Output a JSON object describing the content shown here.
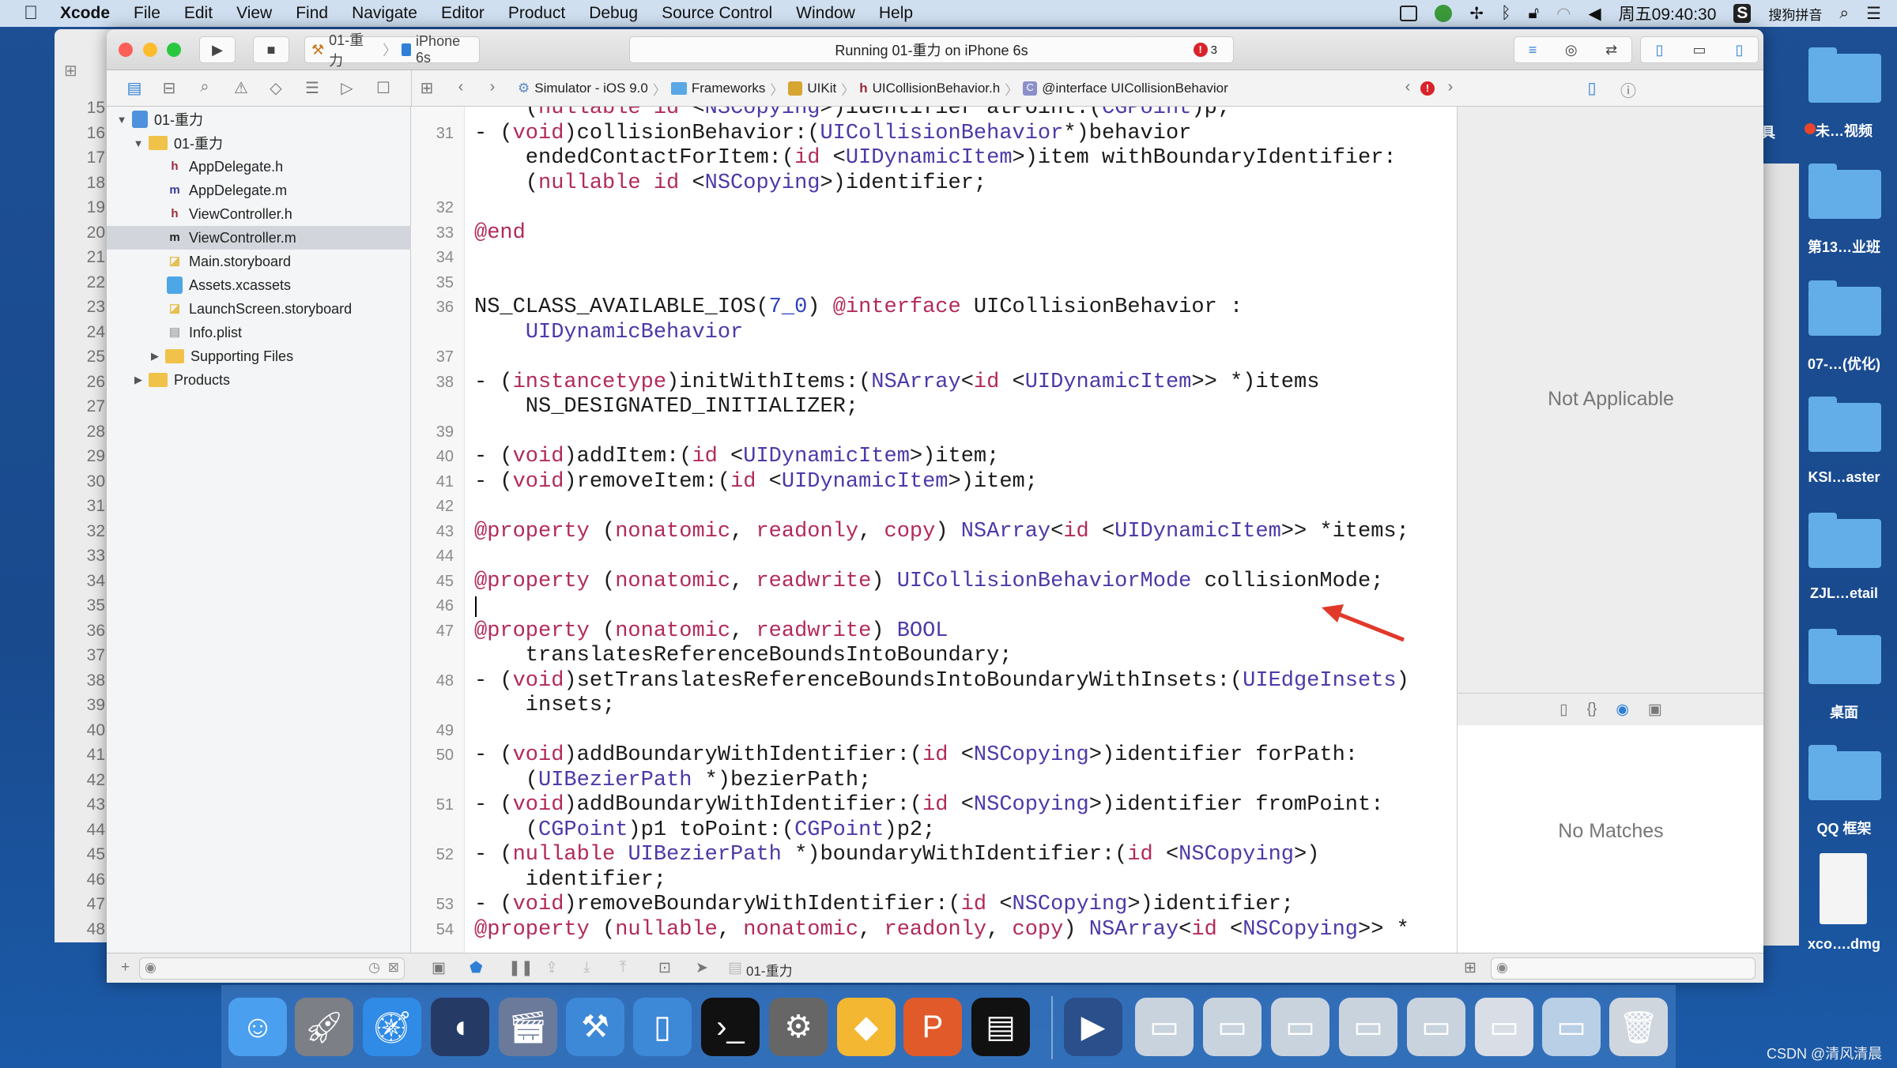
{
  "menubar": {
    "app": "Xcode",
    "items": [
      "File",
      "Edit",
      "View",
      "Find",
      "Navigate",
      "Editor",
      "Product",
      "Debug",
      "Source Control",
      "Window",
      "Help"
    ],
    "clock": "周五09:40:30",
    "ime": "搜狗拼音"
  },
  "toolbar": {
    "scheme": "01-重力",
    "device": "iPhone 6s",
    "status": "Running 01-重力 on iPhone 6s",
    "error_count": "3"
  },
  "jumpbar": {
    "crumbs": [
      "Simulator - iOS 9.0",
      "Frameworks",
      "UIKit",
      "UICollisionBehavior.h",
      "@interface UICollisionBehavior"
    ]
  },
  "navigator": {
    "items": [
      {
        "label": "01-重力",
        "kind": "project",
        "level": 0,
        "expanded": true
      },
      {
        "label": "01-重力",
        "kind": "folder",
        "level": 1,
        "expanded": true
      },
      {
        "label": "AppDelegate.h",
        "kind": "h",
        "level": 2
      },
      {
        "label": "AppDelegate.m",
        "kind": "m",
        "level": 2
      },
      {
        "label": "ViewController.h",
        "kind": "h",
        "level": 2
      },
      {
        "label": "ViewController.m",
        "kind": "m",
        "level": 2,
        "selected": true
      },
      {
        "label": "Main.storyboard",
        "kind": "storyboard",
        "level": 2
      },
      {
        "label": "Assets.xcassets",
        "kind": "assets",
        "level": 2
      },
      {
        "label": "LaunchScreen.storyboard",
        "kind": "storyboard",
        "level": 2
      },
      {
        "label": "Info.plist",
        "kind": "plist",
        "level": 2
      },
      {
        "label": "Supporting Files",
        "kind": "folder",
        "level": 2,
        "expanded": false
      },
      {
        "label": "Products",
        "kind": "folder",
        "level": 1,
        "expanded": false
      }
    ]
  },
  "behind_gutter": [
    "15",
    "16",
    "17",
    "18",
    "19",
    "20",
    "21",
    "22",
    "23",
    "24",
    "25",
    "26",
    "27",
    "28",
    "29",
    "30",
    "31",
    "32",
    "33",
    "34",
    "35",
    "36",
    "37",
    "38",
    "39",
    "40",
    "41",
    "42",
    "43",
    "44",
    "45",
    "46",
    "47",
    "48"
  ],
  "editor": {
    "cursor_line": "46",
    "rows": [
      {
        "n": "",
        "tk": [
          [
            "p",
            "    ("
          ],
          [
            "k",
            "nullable"
          ],
          [
            "p",
            " "
          ],
          [
            "k",
            "id"
          ],
          [
            "p",
            " <"
          ],
          [
            "t",
            "NSCopying"
          ],
          [
            "p",
            ">)identifier atPoint:("
          ],
          [
            "t",
            "CGPoint"
          ],
          [
            "p",
            ")p;"
          ]
        ]
      },
      {
        "n": "31",
        "tk": [
          [
            "p",
            "- ("
          ],
          [
            "k",
            "void"
          ],
          [
            "p",
            ")collisionBehavior:("
          ],
          [
            "t",
            "UICollisionBehavior"
          ],
          [
            "p",
            "*)behavior"
          ]
        ]
      },
      {
        "n": "",
        "tk": [
          [
            "p",
            "    endedContactForItem:("
          ],
          [
            "k",
            "id"
          ],
          [
            "p",
            " <"
          ],
          [
            "t",
            "UIDynamicItem"
          ],
          [
            "p",
            ">)item withBoundaryIdentifier:"
          ]
        ]
      },
      {
        "n": "",
        "tk": [
          [
            "p",
            "    ("
          ],
          [
            "k",
            "nullable"
          ],
          [
            "p",
            " "
          ],
          [
            "k",
            "id"
          ],
          [
            "p",
            " <"
          ],
          [
            "t",
            "NSCopying"
          ],
          [
            "p",
            ">)identifier;"
          ]
        ]
      },
      {
        "n": "32",
        "tk": []
      },
      {
        "n": "33",
        "tk": [
          [
            "k",
            "@end"
          ]
        ]
      },
      {
        "n": "34",
        "tk": []
      },
      {
        "n": "35",
        "tk": []
      },
      {
        "n": "36",
        "tk": [
          [
            "p",
            "NS_CLASS_AVAILABLE_IOS("
          ],
          [
            "n",
            "7_0"
          ],
          [
            "p",
            ") "
          ],
          [
            "k",
            "@interface"
          ],
          [
            "p",
            " UICollisionBehavior :"
          ]
        ]
      },
      {
        "n": "",
        "tk": [
          [
            "p",
            "    "
          ],
          [
            "t",
            "UIDynamicBehavior"
          ]
        ]
      },
      {
        "n": "37",
        "tk": []
      },
      {
        "n": "38",
        "tk": [
          [
            "p",
            "- ("
          ],
          [
            "k",
            "instancetype"
          ],
          [
            "p",
            ")initWithItems:("
          ],
          [
            "t",
            "NSArray"
          ],
          [
            "p",
            "<"
          ],
          [
            "k",
            "id"
          ],
          [
            "p",
            " <"
          ],
          [
            "t",
            "UIDynamicItem"
          ],
          [
            "p",
            ">> *)items"
          ]
        ]
      },
      {
        "n": "",
        "tk": [
          [
            "p",
            "    NS_DESIGNATED_INITIALIZER;"
          ]
        ]
      },
      {
        "n": "39",
        "tk": []
      },
      {
        "n": "40",
        "tk": [
          [
            "p",
            "- ("
          ],
          [
            "k",
            "void"
          ],
          [
            "p",
            ")addItem:("
          ],
          [
            "k",
            "id"
          ],
          [
            "p",
            " <"
          ],
          [
            "t",
            "UIDynamicItem"
          ],
          [
            "p",
            ">)item;"
          ]
        ]
      },
      {
        "n": "41",
        "tk": [
          [
            "p",
            "- ("
          ],
          [
            "k",
            "void"
          ],
          [
            "p",
            ")removeItem:("
          ],
          [
            "k",
            "id"
          ],
          [
            "p",
            " <"
          ],
          [
            "t",
            "UIDynamicItem"
          ],
          [
            "p",
            ">)item;"
          ]
        ]
      },
      {
        "n": "42",
        "tk": []
      },
      {
        "n": "43",
        "tk": [
          [
            "k",
            "@property"
          ],
          [
            "p",
            " ("
          ],
          [
            "k",
            "nonatomic"
          ],
          [
            "p",
            ", "
          ],
          [
            "k",
            "readonly"
          ],
          [
            "p",
            ", "
          ],
          [
            "k",
            "copy"
          ],
          [
            "p",
            ") "
          ],
          [
            "t",
            "NSArray"
          ],
          [
            "p",
            "<"
          ],
          [
            "k",
            "id"
          ],
          [
            "p",
            " <"
          ],
          [
            "t",
            "UIDynamicItem"
          ],
          [
            "p",
            ">> *items;"
          ]
        ]
      },
      {
        "n": "44",
        "tk": []
      },
      {
        "n": "45",
        "tk": [
          [
            "k",
            "@property"
          ],
          [
            "p",
            " ("
          ],
          [
            "k",
            "nonatomic"
          ],
          [
            "p",
            ", "
          ],
          [
            "k",
            "readwrite"
          ],
          [
            "p",
            ") "
          ],
          [
            "t",
            "UICollisionBehaviorMode"
          ],
          [
            "p",
            " collisionMode;"
          ]
        ]
      },
      {
        "n": "46",
        "tk": []
      },
      {
        "n": "47",
        "tk": [
          [
            "k",
            "@property"
          ],
          [
            "p",
            " ("
          ],
          [
            "k",
            "nonatomic"
          ],
          [
            "p",
            ", "
          ],
          [
            "k",
            "readwrite"
          ],
          [
            "p",
            ") "
          ],
          [
            "t",
            "BOOL"
          ]
        ]
      },
      {
        "n": "",
        "tk": [
          [
            "p",
            "    translatesReferenceBoundsIntoBoundary;"
          ]
        ]
      },
      {
        "n": "48",
        "tk": [
          [
            "p",
            "- ("
          ],
          [
            "k",
            "void"
          ],
          [
            "p",
            ")setTranslatesReferenceBoundsIntoBoundaryWithInsets:("
          ],
          [
            "t",
            "UIEdgeInsets"
          ],
          [
            "p",
            ")"
          ]
        ]
      },
      {
        "n": "",
        "tk": [
          [
            "p",
            "    insets;"
          ]
        ]
      },
      {
        "n": "49",
        "tk": []
      },
      {
        "n": "50",
        "tk": [
          [
            "p",
            "- ("
          ],
          [
            "k",
            "void"
          ],
          [
            "p",
            ")addBoundaryWithIdentifier:("
          ],
          [
            "k",
            "id"
          ],
          [
            "p",
            " <"
          ],
          [
            "t",
            "NSCopying"
          ],
          [
            "p",
            ">)identifier forPath:"
          ]
        ]
      },
      {
        "n": "",
        "tk": [
          [
            "p",
            "    ("
          ],
          [
            "t",
            "UIBezierPath"
          ],
          [
            "p",
            " *)bezierPath;"
          ]
        ]
      },
      {
        "n": "51",
        "tk": [
          [
            "p",
            "- ("
          ],
          [
            "k",
            "void"
          ],
          [
            "p",
            ")addBoundaryWithIdentifier:("
          ],
          [
            "k",
            "id"
          ],
          [
            "p",
            " <"
          ],
          [
            "t",
            "NSCopying"
          ],
          [
            "p",
            ">)identifier fromPoint:"
          ]
        ]
      },
      {
        "n": "",
        "tk": [
          [
            "p",
            "    ("
          ],
          [
            "t",
            "CGPoint"
          ],
          [
            "p",
            ")p1 toPoint:("
          ],
          [
            "t",
            "CGPoint"
          ],
          [
            "p",
            ")p2;"
          ]
        ]
      },
      {
        "n": "52",
        "tk": [
          [
            "p",
            "- ("
          ],
          [
            "k",
            "nullable"
          ],
          [
            "p",
            " "
          ],
          [
            "t",
            "UIBezierPath"
          ],
          [
            "p",
            " *)boundaryWithIdentifier:("
          ],
          [
            "k",
            "id"
          ],
          [
            "p",
            " <"
          ],
          [
            "t",
            "NSCopying"
          ],
          [
            "p",
            ">)"
          ]
        ]
      },
      {
        "n": "",
        "tk": [
          [
            "p",
            "    identifier;"
          ]
        ]
      },
      {
        "n": "53",
        "tk": [
          [
            "p",
            "- ("
          ],
          [
            "k",
            "void"
          ],
          [
            "p",
            ")removeBoundaryWithIdentifier:("
          ],
          [
            "k",
            "id"
          ],
          [
            "p",
            " <"
          ],
          [
            "t",
            "NSCopying"
          ],
          [
            "p",
            ">)identifier;"
          ]
        ]
      },
      {
        "n": "54",
        "tk": [
          [
            "k",
            "@property"
          ],
          [
            "p",
            " ("
          ],
          [
            "k",
            "nullable"
          ],
          [
            "p",
            ", "
          ],
          [
            "k",
            "nonatomic"
          ],
          [
            "p",
            ", "
          ],
          [
            "k",
            "readonly"
          ],
          [
            "p",
            ", "
          ],
          [
            "k",
            "copy"
          ],
          [
            "p",
            ") "
          ],
          [
            "t",
            "NSArray"
          ],
          [
            "p",
            "<"
          ],
          [
            "k",
            "id"
          ],
          [
            "p",
            " <"
          ],
          [
            "t",
            "NSCopying"
          ],
          [
            "p",
            ">> *"
          ]
        ]
      }
    ]
  },
  "inspector": {
    "not_applicable": "Not Applicable",
    "no_matches": "No Matches"
  },
  "debugbar": {
    "target": "01-重力"
  },
  "desktop": {
    "icons": [
      {
        "label": "未…视频",
        "tag_color": "#e8442e"
      },
      {
        "label": "第13…业班"
      },
      {
        "label": "07-…(优化)"
      },
      {
        "label": "KSI…aster"
      },
      {
        "label": "ZJL…etail"
      },
      {
        "label": "桌面"
      },
      {
        "label": "QQ 框架"
      },
      {
        "label": "xco….dmg",
        "kind": "dmg"
      }
    ],
    "partial_label": "工具"
  },
  "dock": [
    "finder-icon",
    "launchpad-icon",
    "safari-icon",
    "mouse-app-icon",
    "video-app-icon",
    "xcode-icon",
    "simulator-icon",
    "terminal-icon",
    "system-preferences-icon",
    "sketch-icon",
    "p-app-icon",
    "console-icon",
    "quicktime-icon",
    "screenshot-icon",
    "screenshot-icon",
    "screenshot-icon",
    "screenshot-icon",
    "screenshot-icon",
    "preview-icon",
    "window-icon",
    "trash-icon"
  ],
  "watermark": "CSDN @清风清晨",
  "colors": {
    "keyword": "#b22a5b",
    "type": "#4a3aa8",
    "number": "#2c3fbf",
    "error": "#d8232a",
    "annotation_arrow": "#e0392b"
  }
}
